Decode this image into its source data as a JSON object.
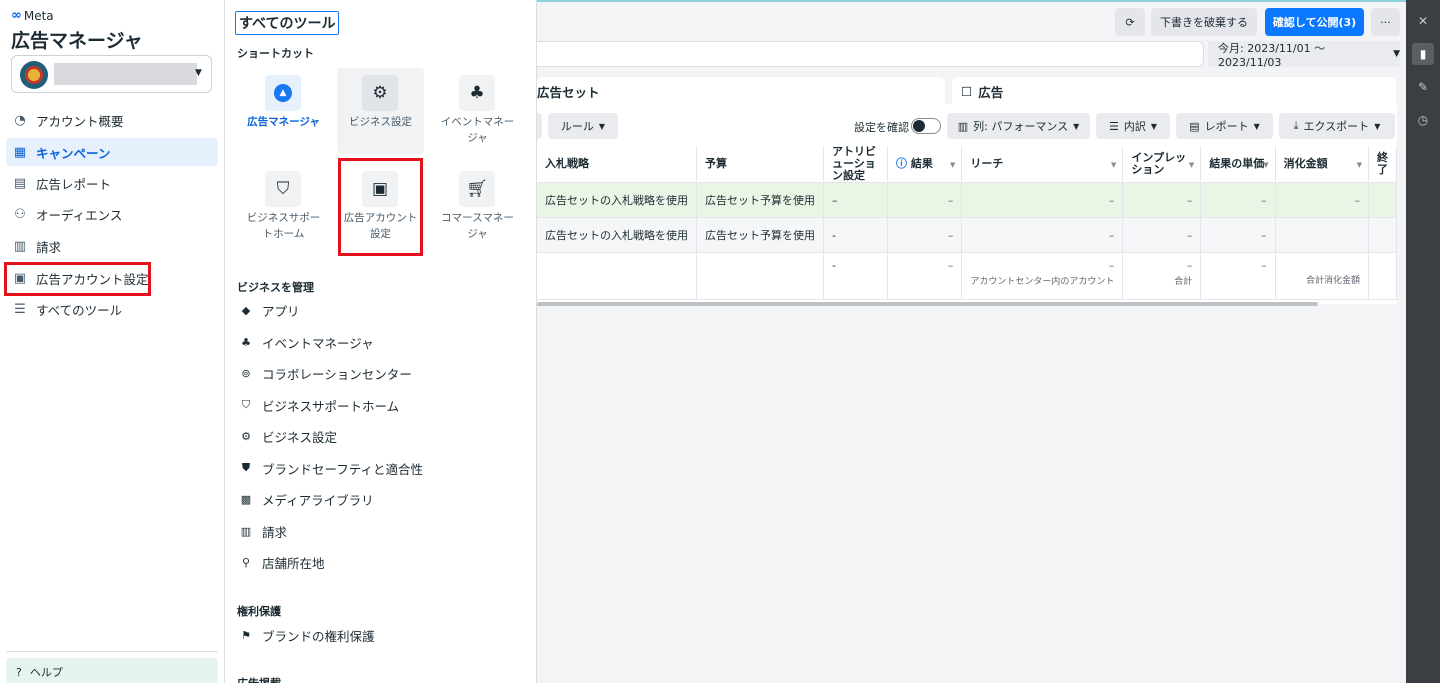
{
  "nav": {
    "brand": "Meta",
    "title": "広告マネージャ",
    "items": [
      {
        "label": "アカウント概要",
        "icon": "gauge-icon"
      },
      {
        "label": "キャンペーン",
        "icon": "table-grid-icon"
      },
      {
        "label": "広告レポート",
        "icon": "report-icon"
      },
      {
        "label": "オーディエンス",
        "icon": "people-icon"
      },
      {
        "label": "請求",
        "icon": "billing-icon"
      },
      {
        "label": "広告アカウント設定",
        "icon": "ad-account-settings-icon"
      },
      {
        "label": "すべてのツール",
        "icon": "menu-lines-icon"
      }
    ],
    "active_index": 1,
    "help_label": "ヘルプ"
  },
  "tools": {
    "title": "すべてのツール",
    "shortcuts_title": "ショートカット",
    "shortcuts": [
      {
        "label": "広告マネージャ",
        "icon": "ads-manager-icon"
      },
      {
        "label": "ビジネス設定",
        "icon": "gear-icon"
      },
      {
        "label": "イベントマネージャ",
        "icon": "events-manager-icon"
      },
      {
        "label": "ビジネスサポートホーム",
        "icon": "support-shield-icon"
      },
      {
        "label": "広告アカウント設定",
        "icon": "ad-account-settings-icon"
      },
      {
        "label": "コマースマネージャ",
        "icon": "cart-icon"
      }
    ],
    "business_title": "ビジネスを管理",
    "business_items": [
      {
        "label": "アプリ",
        "icon": "cube-icon"
      },
      {
        "label": "イベントマネージャ",
        "icon": "events-manager-icon"
      },
      {
        "label": "コラボレーションセンター",
        "icon": "handshake-icon"
      },
      {
        "label": "ビジネスサポートホーム",
        "icon": "support-shield-icon"
      },
      {
        "label": "ビジネス設定",
        "icon": "gear-icon"
      },
      {
        "label": "ブランドセーフティと適合性",
        "icon": "shield-icon"
      },
      {
        "label": "メディアライブラリ",
        "icon": "media-library-icon"
      },
      {
        "label": "請求",
        "icon": "billing-icon"
      },
      {
        "label": "店舗所在地",
        "icon": "store-location-icon"
      }
    ],
    "rights_title": "権利保護",
    "rights_items": [
      {
        "label": "ブランドの権利保護",
        "icon": "flag-icon"
      }
    ],
    "ads_title": "広告掲載"
  },
  "topbar": {
    "discard_label": "下書きを破棄する",
    "publish_label": "確認して公開(3)",
    "more_label": "···",
    "date_range": "今月: 2023/11/01 〜 2023/11/03"
  },
  "tabs": {
    "adset": "広告セット",
    "ad": "広告"
  },
  "toolbar": {
    "rules": "ルール",
    "review_toggle_label": "設定を確認",
    "columns": "列: パフォーマンス",
    "breakdown": "内訳",
    "reports": "レポート",
    "export": "エクスポート"
  },
  "table": {
    "headers": [
      "入札戦略",
      "予算",
      "アトリビューション設定",
      "結果",
      "リーチ",
      "インプレッション",
      "結果の単価",
      "消化金額",
      "終了"
    ],
    "rows": [
      [
        "広告セットの入札戦略を使用",
        "広告セット予算を使用",
        "–",
        "–",
        "–",
        "–",
        "–",
        "–"
      ],
      [
        "広告セットの入札戦略を使用",
        "広告セット予算を使用",
        "-",
        "–",
        "–",
        "–",
        "–",
        ""
      ]
    ],
    "total": {
      "attribution": "-",
      "results": "–",
      "reach": "–",
      "reach_sub": "アカウントセンター内のアカウント",
      "impressions": "–",
      "impressions_sub": "合計",
      "cpr": "–",
      "spend_sub": "合計消化金額"
    }
  },
  "colors": {
    "accent": "#0a78ff",
    "highlight": "#e4111d",
    "green_row": "#eaf5e6"
  }
}
